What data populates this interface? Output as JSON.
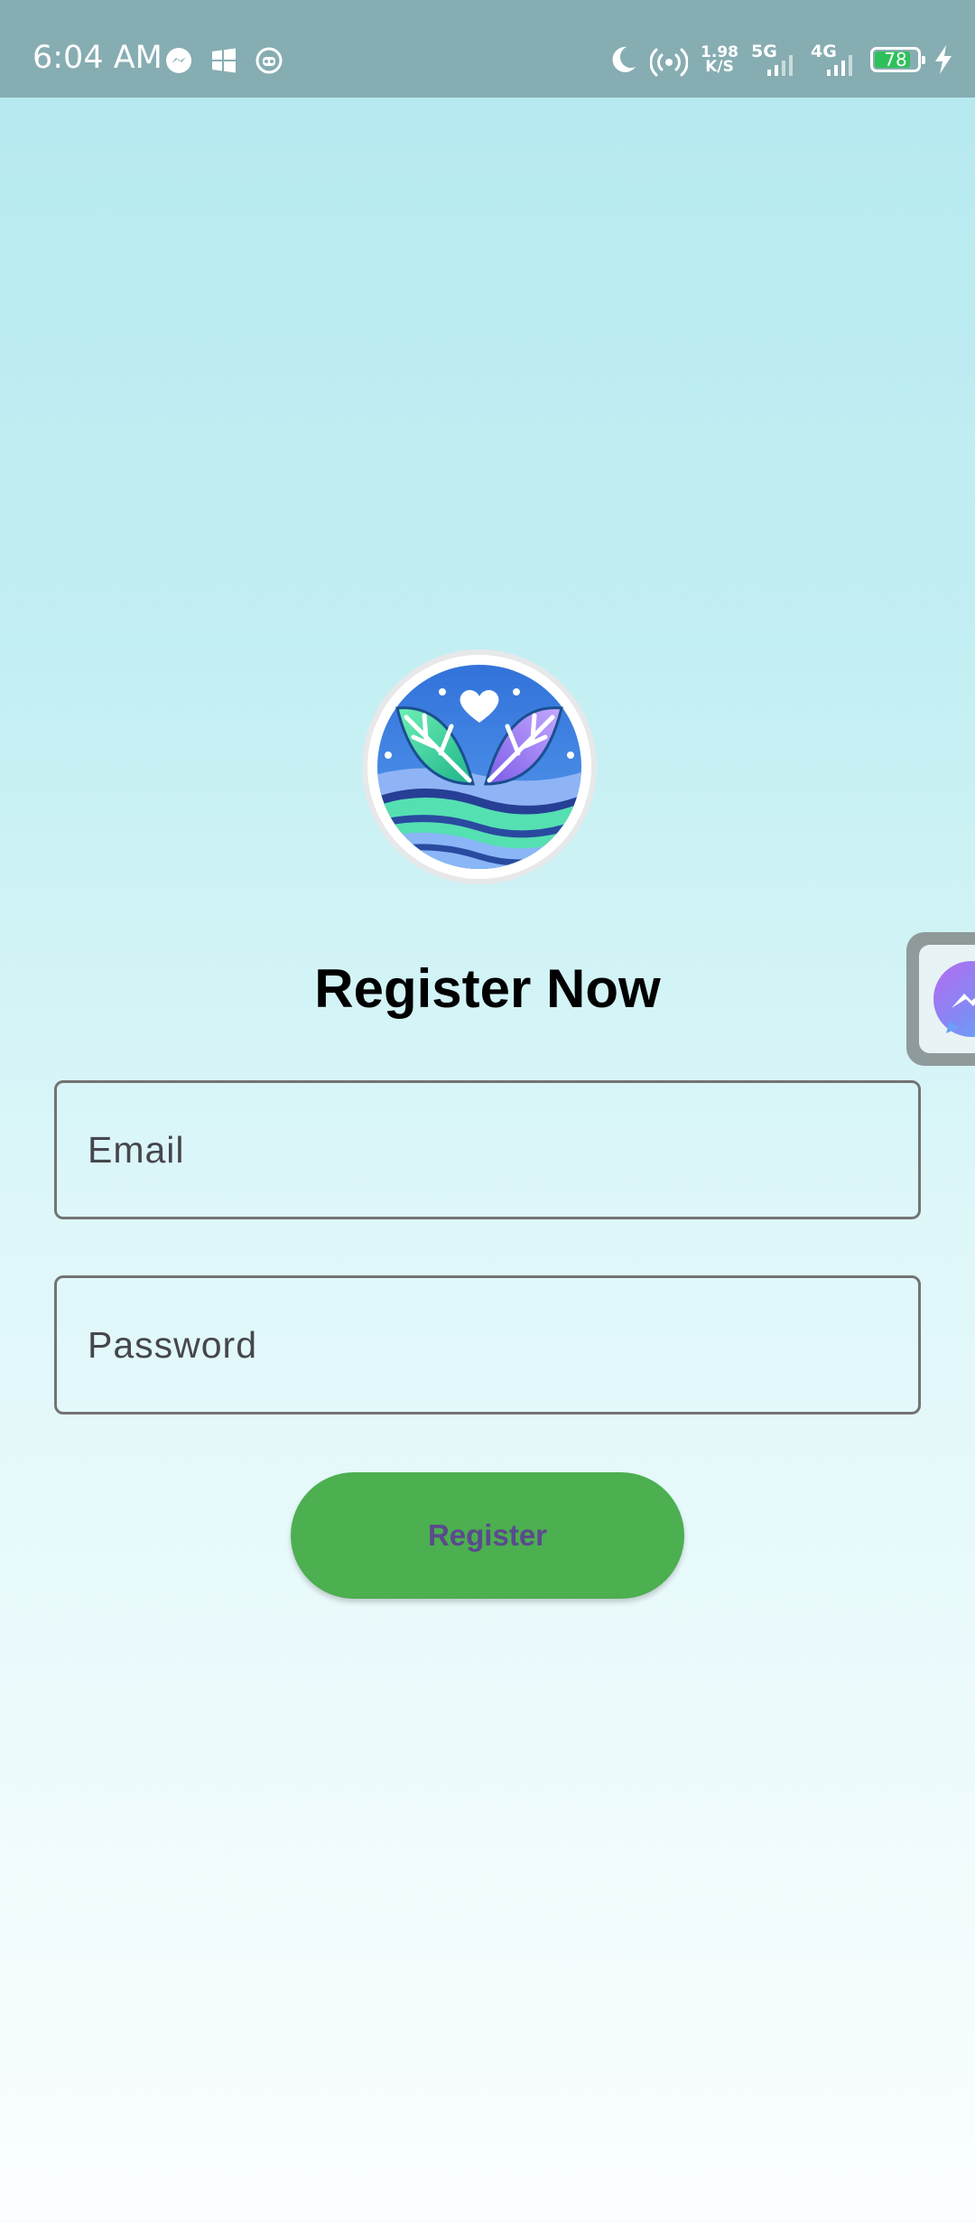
{
  "status_bar": {
    "time": "6:04 AM",
    "left_icons": [
      "messenger-icon",
      "windows-icon",
      "robot-icon"
    ],
    "net_speed_value": "1.98",
    "net_speed_unit": "K/S",
    "signal_1_label": "5G",
    "signal_2_label": "4G",
    "battery_level": "78",
    "right_icons": [
      "moon-icon",
      "hotspot-icon",
      "charging-icon"
    ]
  },
  "screen": {
    "title": "Register Now",
    "email_placeholder": "Email",
    "password_placeholder": "Password",
    "register_label": "Register"
  },
  "colors": {
    "status_bar_bg": "#86adb2",
    "button_bg": "#4caf50",
    "button_text": "#5b4a8d",
    "field_border": "#737373",
    "background_top": "#b4e9ef",
    "background_bottom": "#fbfeff"
  },
  "floating_chat_head": {
    "icon": "messenger-bubble-icon"
  }
}
